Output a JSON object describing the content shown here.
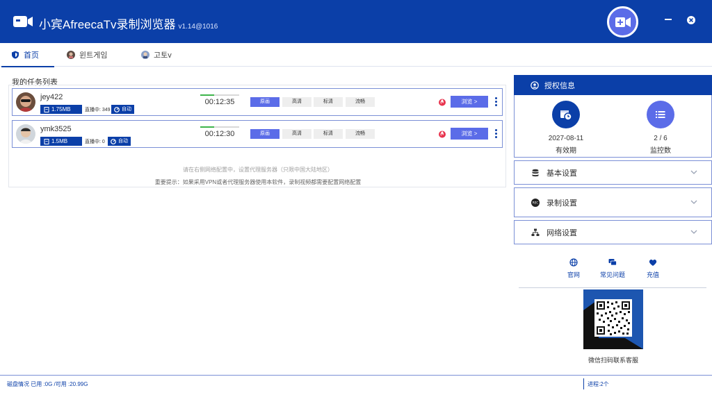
{
  "app": {
    "title": "小宾AfreecaTv录制浏览器",
    "version": "v1.14@1016",
    "brand_color": "#0b3fa8",
    "accent_color": "#5b6ce8",
    "icons": {
      "logo": "video-camera-icon",
      "record": "video-camera-plus-icon",
      "minimize": "minimize-icon",
      "close": "close-icon"
    }
  },
  "tabs": [
    {
      "label": "首页",
      "icon": "shield-icon",
      "active": true
    },
    {
      "label": "윈트게임",
      "icon": "avatar-icon",
      "active": false
    },
    {
      "label": "고토v",
      "icon": "avatar-icon",
      "active": false
    }
  ],
  "task_list": {
    "title": "我的任务列表",
    "tasks": [
      {
        "username": "jey422",
        "size": "1.75MB",
        "count_label": "直播中",
        "count": "349",
        "auto_label": "自动",
        "time": "00:12:35",
        "progress_percent": 35,
        "qualities": [
          "原画",
          "高清",
          "标清",
          "流畅"
        ],
        "active_quality": "原画",
        "browse_label": "浏览 >"
      },
      {
        "username": "ymk3525",
        "size": "1.5MB",
        "count_label": "直播中",
        "count": "0",
        "auto_label": "自动",
        "time": "00:12:30",
        "progress_percent": 35,
        "qualities": [
          "原画",
          "高清",
          "标清",
          "流畅"
        ],
        "active_quality": "原画",
        "browse_label": "浏览 >"
      }
    ],
    "hint_proxy": "请在右侧网络配置中，设置代理服务器（只限中国大陆地区）",
    "hint_important": "重要提示：如果采用VPN或者代理服务器使用本软件，录制视频都需要配置网络配置"
  },
  "sidebar": {
    "auth": {
      "title": "授权信息",
      "expire_value": "2027-08-11",
      "expire_label": "有效期",
      "monitor_value": "2 / 6",
      "monitor_label": "监控数"
    },
    "sections": [
      {
        "label": "基本设置",
        "icon": "database-icon"
      },
      {
        "label": "录制设置",
        "icon": "rec-icon"
      },
      {
        "label": "网络设置",
        "icon": "network-icon"
      }
    ],
    "links": [
      {
        "label": "官网",
        "icon": "globe-icon"
      },
      {
        "label": "常见问题",
        "icon": "chat-icon"
      },
      {
        "label": "充值",
        "icon": "heart-icon"
      }
    ],
    "qr_caption": "微信扫码联系客服"
  },
  "statusbar": {
    "disk": "磁盘情况 已用 :0G /可用 :20.99G",
    "process": "进程:2个"
  }
}
